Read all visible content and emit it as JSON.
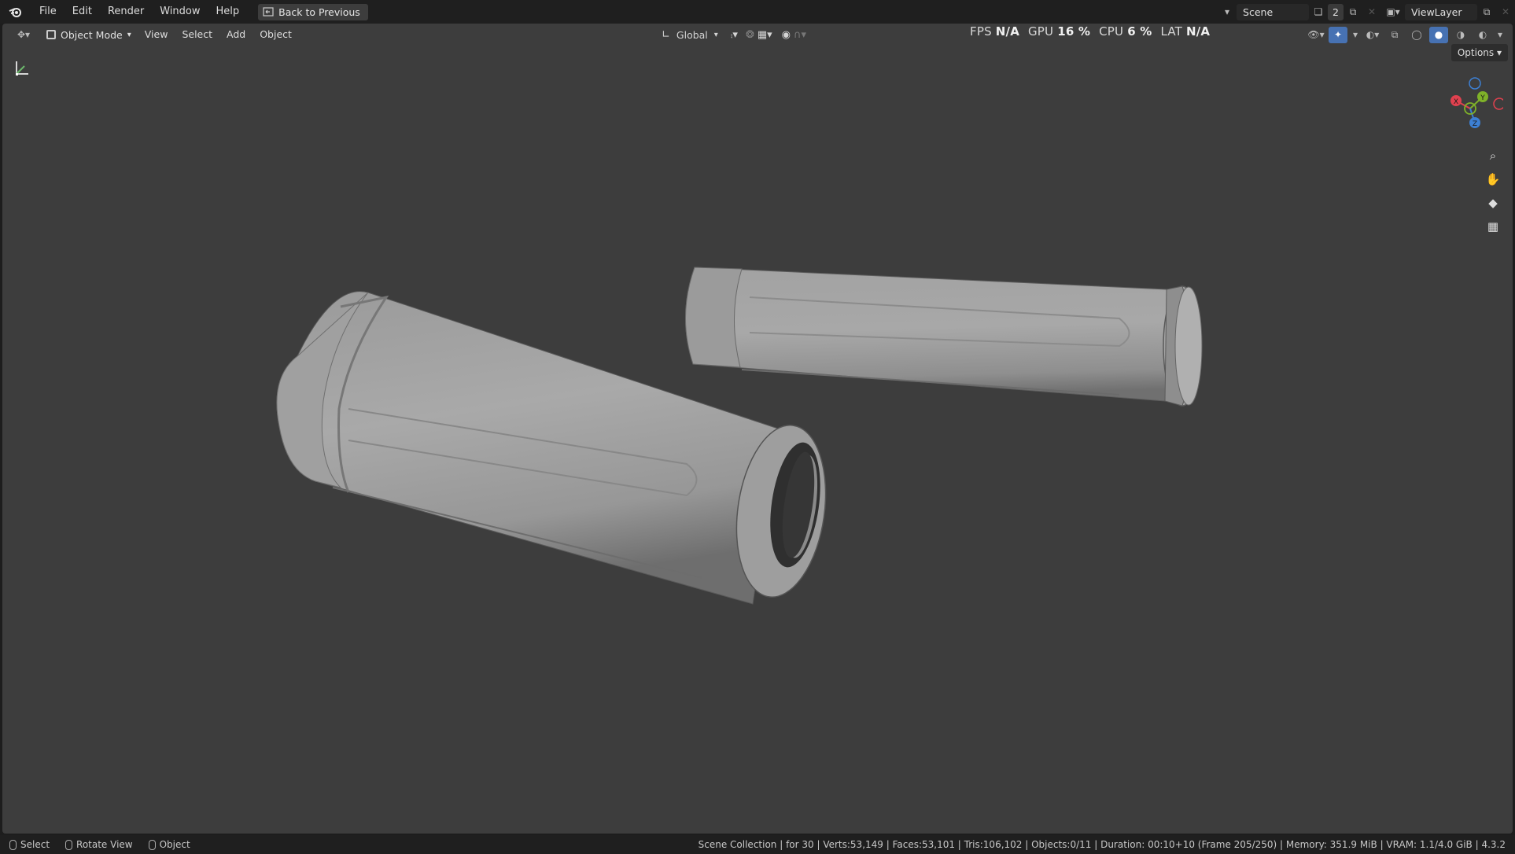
{
  "menu": {
    "items": [
      "File",
      "Edit",
      "Render",
      "Window",
      "Help"
    ],
    "back_button": "Back to Previous"
  },
  "top_right": {
    "scene": "Scene",
    "scene_users": "2",
    "view_layer": "ViewLayer"
  },
  "viewport_header": {
    "mode": "Object Mode",
    "menus": [
      "View",
      "Select",
      "Add",
      "Object"
    ],
    "orientation": "Global",
    "options": "Options"
  },
  "perf": {
    "fps_label": "FPS",
    "fps_value": "N/A",
    "gpu_label": "GPU",
    "gpu_value": "16 %",
    "cpu_label": "CPU",
    "cpu_value": "6 %",
    "lat_label": "LAT",
    "lat_value": "N/A"
  },
  "gizmo": {
    "x": "X",
    "y": "Y",
    "z": "Z"
  },
  "status": {
    "select": "Select",
    "rotate": "Rotate View",
    "object": "Object",
    "stats": "Scene Collection | for 30 | Verts:53,149 | Faces:53,101 | Tris:106,102 | Objects:0/11 | Duration: 00:10+10 (Frame 205/250) | Memory: 351.9 MiB | VRAM: 1.1/4.0 GiB | 4.3.2"
  },
  "colors": {
    "viewport_bg": "#3d3d3d",
    "axis_x": "#e0414f",
    "axis_y": "#7fb229",
    "axis_z": "#3d80d4"
  }
}
